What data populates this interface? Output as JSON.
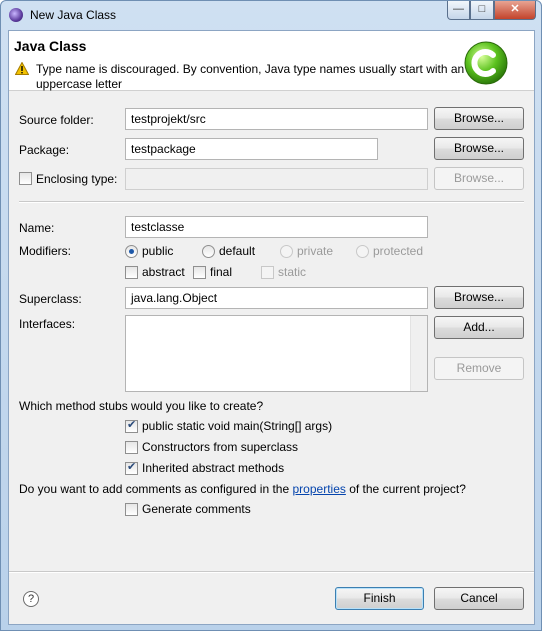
{
  "window": {
    "title": "New Java Class"
  },
  "header": {
    "title": "Java Class",
    "message": "Type name is discouraged. By convention, Java type names usually start with an uppercase letter",
    "logo_icon": "new-class-wizard-icon"
  },
  "source_folder": {
    "label": "Source folder:",
    "value": "testprojekt/src",
    "browse": "Browse..."
  },
  "package": {
    "label": "Package:",
    "value": "testpackage",
    "browse": "Browse..."
  },
  "enclosing_type": {
    "label": "Enclosing type:",
    "checked": false,
    "value": "",
    "browse": "Browse..."
  },
  "name": {
    "label": "Name:",
    "value": "testclasse"
  },
  "modifiers": {
    "label": "Modifiers:",
    "access": [
      {
        "label": "public",
        "selected": true,
        "enabled": true
      },
      {
        "label": "default",
        "selected": false,
        "enabled": true
      },
      {
        "label": "private",
        "selected": false,
        "enabled": false
      },
      {
        "label": "protected",
        "selected": false,
        "enabled": false
      }
    ],
    "other": [
      {
        "label": "abstract",
        "checked": false,
        "enabled": true
      },
      {
        "label": "final",
        "checked": false,
        "enabled": true
      },
      {
        "label": "static",
        "checked": false,
        "enabled": false
      }
    ]
  },
  "superclass": {
    "label": "Superclass:",
    "value": "java.lang.Object",
    "browse": "Browse..."
  },
  "interfaces": {
    "label": "Interfaces:",
    "add": "Add...",
    "remove": "Remove",
    "items": []
  },
  "stubs": {
    "question": "Which method stubs would you like to create?",
    "options": [
      {
        "label": "public static void main(String[] args)",
        "checked": true
      },
      {
        "label": "Constructors from superclass",
        "checked": false
      },
      {
        "label": "Inherited abstract methods",
        "checked": true
      }
    ]
  },
  "comments": {
    "question_before": "Do you want to add comments as configured in the ",
    "link": "properties",
    "question_after": " of the current project?",
    "option": {
      "label": "Generate comments",
      "checked": false
    }
  },
  "footer": {
    "finish": "Finish",
    "cancel": "Cancel",
    "help_icon": "help-icon"
  },
  "colors": {
    "link": "#0645ad",
    "title_gradient_top": "#cfe0f2",
    "close_button": "#c3432b",
    "warning": "#f2c200"
  }
}
